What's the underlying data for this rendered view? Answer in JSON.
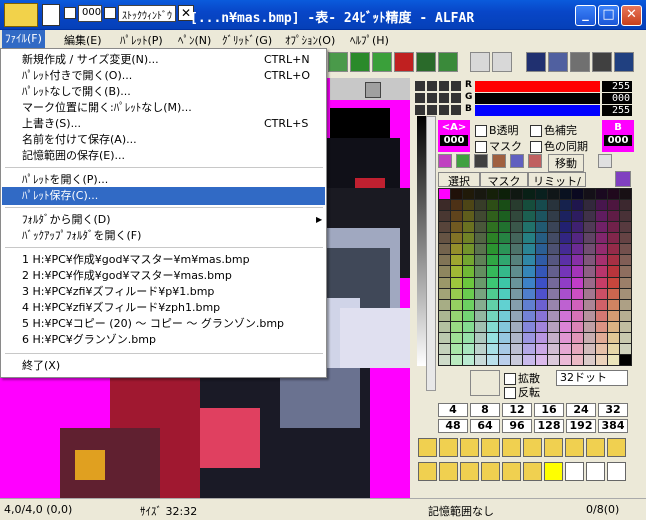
{
  "window": {
    "title": "[...n¥mas.bmp] -表- 24ﾋﾞｯﾄ精度 - ALFAR",
    "title_checkbox_value": "000",
    "stock_window_label": "ｽﾄｯｸｳｨﾝﾄﾞｳ",
    "close_label": "✕"
  },
  "menubar": [
    {
      "label": "ﾌｧｲﾙ(F)"
    },
    {
      "label": "編集(E)"
    },
    {
      "label": "ﾊﾟﾚｯﾄ(P)"
    },
    {
      "label": "ﾍﾟﾝ(N)"
    },
    {
      "label": "ｸﾞﾘｯﾄﾞ(G)"
    },
    {
      "label": "ｵﾌﾟｼｮﾝ(O)"
    },
    {
      "label": "ﾍﾙﾌﾟ(H)"
    }
  ],
  "file_menu": {
    "items": [
      {
        "label": "新規作成 / サイズ変更(N)...",
        "shortcut": "CTRL+N"
      },
      {
        "label": "ﾊﾟﾚｯﾄ付きで開く(O)...",
        "shortcut": "CTRL+O"
      },
      {
        "label": "ﾊﾟﾚｯﾄなしで開く(B)...",
        "shortcut": ""
      },
      {
        "label": "マーク位置に開く:ﾊﾟﾚｯﾄなし(M)...",
        "shortcut": ""
      },
      {
        "label": "上書き(S)...",
        "shortcut": "CTRL+S"
      },
      {
        "label": "名前を付けて保存(A)...",
        "shortcut": ""
      },
      {
        "label": "記憶範囲の保存(E)...",
        "shortcut": ""
      },
      {
        "label": "ﾊﾟﾚｯﾄを開く(P)...",
        "shortcut": ""
      },
      {
        "label": "ﾊﾟﾚｯﾄ保存(C)...",
        "shortcut": ""
      },
      {
        "label": "ﾌｫﾙﾀﾞから開く(D)",
        "shortcut": ""
      },
      {
        "label": "ﾊﾞｯｸｱｯﾌﾟﾌｫﾙﾀﾞを開く(F)",
        "shortcut": ""
      },
      {
        "label": "1 H:¥PC¥作成¥god¥マスター¥m¥mas.bmp",
        "shortcut": ""
      },
      {
        "label": "2 H:¥PC¥作成¥god¥マスター¥mas.bmp",
        "shortcut": ""
      },
      {
        "label": "3 H:¥PC¥zfi¥ズフィルード¥p¥1.bmp",
        "shortcut": ""
      },
      {
        "label": "4 H:¥PC¥zfi¥ズフィルード¥zph1.bmp",
        "shortcut": ""
      },
      {
        "label": "5 H:¥PC¥コピー (20) ～ コピー ～ グランゾン.bmp",
        "shortcut": ""
      },
      {
        "label": "6 H:¥PC¥グランゾン.bmp",
        "shortcut": ""
      },
      {
        "label": "終了(X)",
        "shortcut": ""
      }
    ]
  },
  "color_panel": {
    "r_label": "R",
    "g_label": "G",
    "b_label": "B",
    "r_value": "255",
    "g_value": "000",
    "b_value": "255",
    "r_color": "#ff0000",
    "g_color": "#000000",
    "b_color": "#0000ff",
    "a_label": "<A>",
    "a_value": "000",
    "b_box_label": "B",
    "b_box_value": "000",
    "b_transparent": "B透明",
    "color_complement": "色補完",
    "mask": "マスク",
    "color_sync": "色の同期",
    "move": "移動"
  },
  "tabs": [
    {
      "label": "選択"
    },
    {
      "label": "マスク"
    },
    {
      "label": "リミット/除"
    }
  ],
  "zoom": {
    "expand_label": "拡散",
    "reverse_label": "反転",
    "dot_select": "32ドット"
  },
  "number_grid": [
    "4",
    "8",
    "12",
    "16",
    "24",
    "32",
    "48",
    "64",
    "96",
    "128",
    "192",
    "384"
  ],
  "status": {
    "coords": "4,0/4,0 (0,0)",
    "size": "ｻｲｽﾞ 32:32",
    "memory": "記憶範囲なし",
    "count": "0/8(0)"
  }
}
